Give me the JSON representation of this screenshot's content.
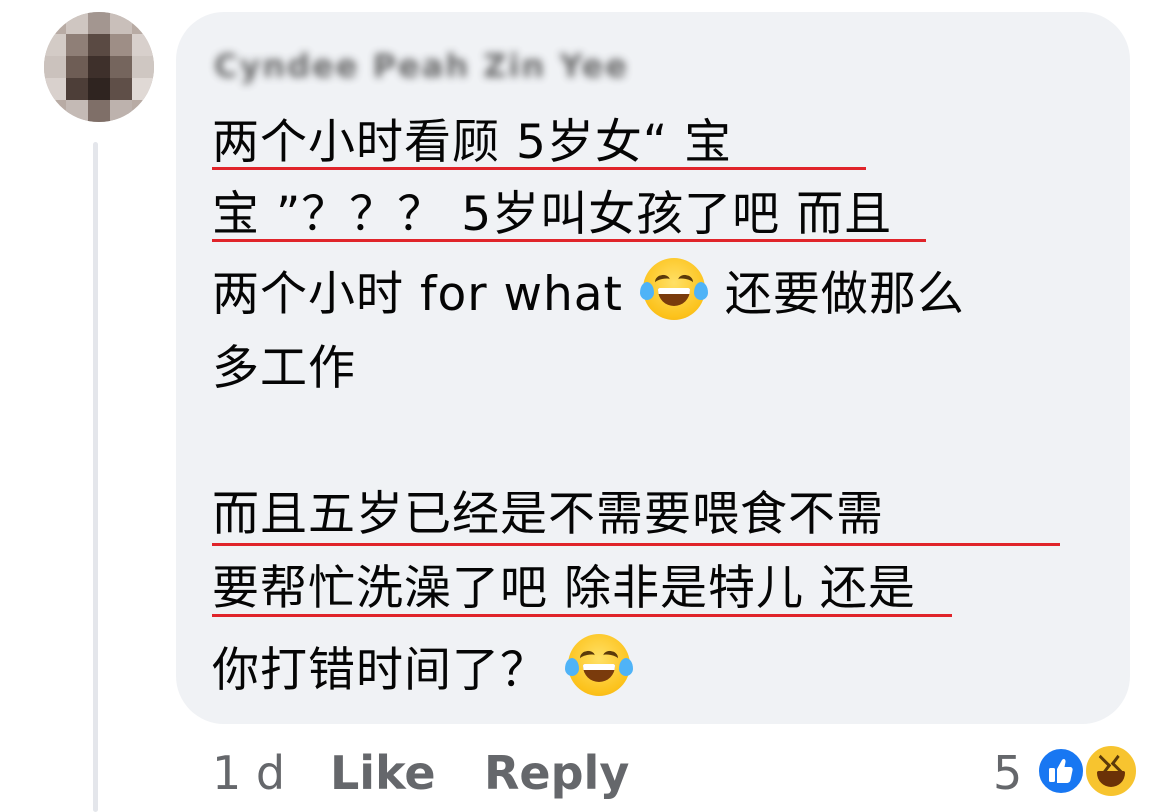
{
  "comment": {
    "author_name": "Cyndee Peah Zin Yee",
    "lines": [
      "两个小时看顾 5岁女“ 宝",
      "宝 ”？？？ 5岁叫女孩了吧 而且",
      "两个小时 for what",
      "还要做那么",
      "多工作",
      "而且五岁已经是不需要喂食不需",
      "要帮忙洗澡了吧 除非是特儿 还是",
      "你打错时间了？"
    ],
    "emoji_icon": "face-with-tears-of-joy-icon"
  },
  "footer": {
    "time": "1 d",
    "like_label": "Like",
    "reply_label": "Reply"
  },
  "reactions": {
    "count": "5",
    "icons": [
      "like-reaction-icon",
      "haha-reaction-icon"
    ]
  },
  "colors": {
    "bubble": "#f0f2f5",
    "text": "#050505",
    "meta": "#65676b",
    "underline": "#e0242a",
    "like_blue": "#1877f2"
  }
}
